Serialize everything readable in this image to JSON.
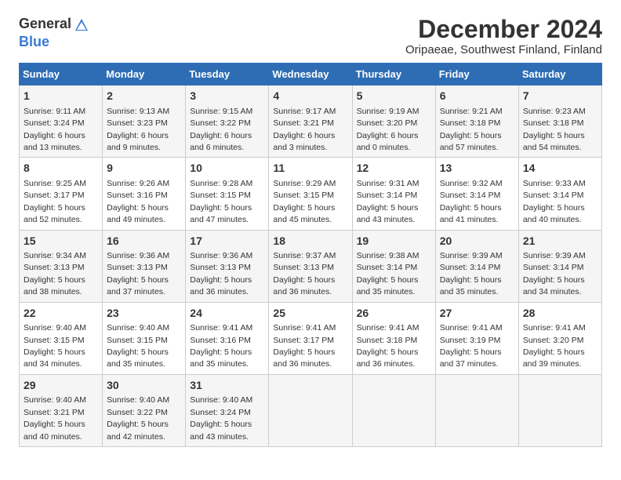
{
  "header": {
    "logo_general": "General",
    "logo_blue": "Blue",
    "title": "December 2024",
    "subtitle": "Oripaeae, Southwest Finland, Finland"
  },
  "calendar": {
    "days_of_week": [
      "Sunday",
      "Monday",
      "Tuesday",
      "Wednesday",
      "Thursday",
      "Friday",
      "Saturday"
    ],
    "weeks": [
      [
        {
          "day": "1",
          "info": "Sunrise: 9:11 AM\nSunset: 3:24 PM\nDaylight: 6 hours\nand 13 minutes."
        },
        {
          "day": "2",
          "info": "Sunrise: 9:13 AM\nSunset: 3:23 PM\nDaylight: 6 hours\nand 9 minutes."
        },
        {
          "day": "3",
          "info": "Sunrise: 9:15 AM\nSunset: 3:22 PM\nDaylight: 6 hours\nand 6 minutes."
        },
        {
          "day": "4",
          "info": "Sunrise: 9:17 AM\nSunset: 3:21 PM\nDaylight: 6 hours\nand 3 minutes."
        },
        {
          "day": "5",
          "info": "Sunrise: 9:19 AM\nSunset: 3:20 PM\nDaylight: 6 hours\nand 0 minutes."
        },
        {
          "day": "6",
          "info": "Sunrise: 9:21 AM\nSunset: 3:18 PM\nDaylight: 5 hours\nand 57 minutes."
        },
        {
          "day": "7",
          "info": "Sunrise: 9:23 AM\nSunset: 3:18 PM\nDaylight: 5 hours\nand 54 minutes."
        }
      ],
      [
        {
          "day": "8",
          "info": "Sunrise: 9:25 AM\nSunset: 3:17 PM\nDaylight: 5 hours\nand 52 minutes."
        },
        {
          "day": "9",
          "info": "Sunrise: 9:26 AM\nSunset: 3:16 PM\nDaylight: 5 hours\nand 49 minutes."
        },
        {
          "day": "10",
          "info": "Sunrise: 9:28 AM\nSunset: 3:15 PM\nDaylight: 5 hours\nand 47 minutes."
        },
        {
          "day": "11",
          "info": "Sunrise: 9:29 AM\nSunset: 3:15 PM\nDaylight: 5 hours\nand 45 minutes."
        },
        {
          "day": "12",
          "info": "Sunrise: 9:31 AM\nSunset: 3:14 PM\nDaylight: 5 hours\nand 43 minutes."
        },
        {
          "day": "13",
          "info": "Sunrise: 9:32 AM\nSunset: 3:14 PM\nDaylight: 5 hours\nand 41 minutes."
        },
        {
          "day": "14",
          "info": "Sunrise: 9:33 AM\nSunset: 3:14 PM\nDaylight: 5 hours\nand 40 minutes."
        }
      ],
      [
        {
          "day": "15",
          "info": "Sunrise: 9:34 AM\nSunset: 3:13 PM\nDaylight: 5 hours\nand 38 minutes."
        },
        {
          "day": "16",
          "info": "Sunrise: 9:36 AM\nSunset: 3:13 PM\nDaylight: 5 hours\nand 37 minutes."
        },
        {
          "day": "17",
          "info": "Sunrise: 9:36 AM\nSunset: 3:13 PM\nDaylight: 5 hours\nand 36 minutes."
        },
        {
          "day": "18",
          "info": "Sunrise: 9:37 AM\nSunset: 3:13 PM\nDaylight: 5 hours\nand 36 minutes."
        },
        {
          "day": "19",
          "info": "Sunrise: 9:38 AM\nSunset: 3:14 PM\nDaylight: 5 hours\nand 35 minutes."
        },
        {
          "day": "20",
          "info": "Sunrise: 9:39 AM\nSunset: 3:14 PM\nDaylight: 5 hours\nand 35 minutes."
        },
        {
          "day": "21",
          "info": "Sunrise: 9:39 AM\nSunset: 3:14 PM\nDaylight: 5 hours\nand 34 minutes."
        }
      ],
      [
        {
          "day": "22",
          "info": "Sunrise: 9:40 AM\nSunset: 3:15 PM\nDaylight: 5 hours\nand 34 minutes."
        },
        {
          "day": "23",
          "info": "Sunrise: 9:40 AM\nSunset: 3:15 PM\nDaylight: 5 hours\nand 35 minutes."
        },
        {
          "day": "24",
          "info": "Sunrise: 9:41 AM\nSunset: 3:16 PM\nDaylight: 5 hours\nand 35 minutes."
        },
        {
          "day": "25",
          "info": "Sunrise: 9:41 AM\nSunset: 3:17 PM\nDaylight: 5 hours\nand 36 minutes."
        },
        {
          "day": "26",
          "info": "Sunrise: 9:41 AM\nSunset: 3:18 PM\nDaylight: 5 hours\nand 36 minutes."
        },
        {
          "day": "27",
          "info": "Sunrise: 9:41 AM\nSunset: 3:19 PM\nDaylight: 5 hours\nand 37 minutes."
        },
        {
          "day": "28",
          "info": "Sunrise: 9:41 AM\nSunset: 3:20 PM\nDaylight: 5 hours\nand 39 minutes."
        }
      ],
      [
        {
          "day": "29",
          "info": "Sunrise: 9:40 AM\nSunset: 3:21 PM\nDaylight: 5 hours\nand 40 minutes."
        },
        {
          "day": "30",
          "info": "Sunrise: 9:40 AM\nSunset: 3:22 PM\nDaylight: 5 hours\nand 42 minutes."
        },
        {
          "day": "31",
          "info": "Sunrise: 9:40 AM\nSunset: 3:24 PM\nDaylight: 5 hours\nand 43 minutes."
        },
        {
          "day": "",
          "info": ""
        },
        {
          "day": "",
          "info": ""
        },
        {
          "day": "",
          "info": ""
        },
        {
          "day": "",
          "info": ""
        }
      ]
    ]
  }
}
